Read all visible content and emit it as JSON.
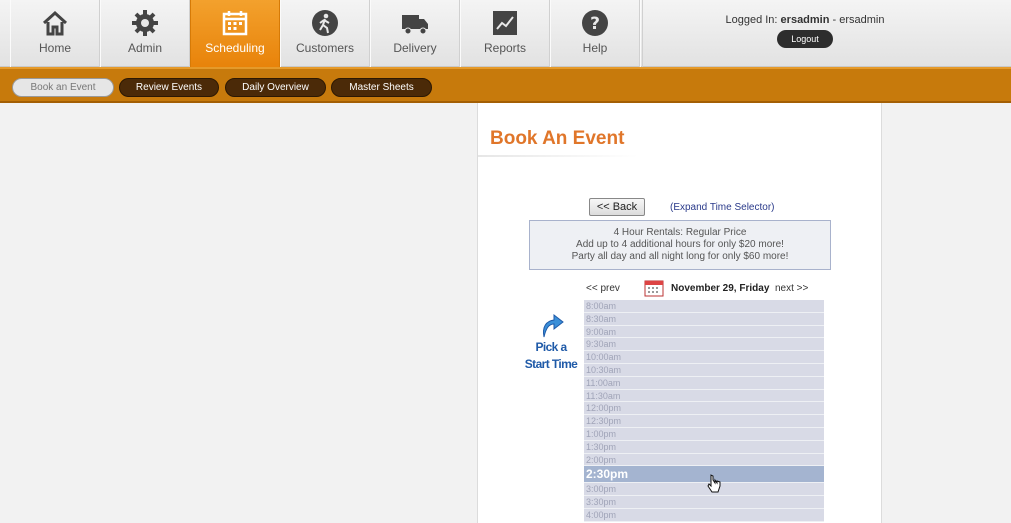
{
  "nav": {
    "items": [
      {
        "label": "Home",
        "icon": "home-icon"
      },
      {
        "label": "Admin",
        "icon": "gear-icon"
      },
      {
        "label": "Scheduling",
        "icon": "calendar-icon"
      },
      {
        "label": "Customers",
        "icon": "walking-person-icon"
      },
      {
        "label": "Delivery",
        "icon": "truck-icon"
      },
      {
        "label": "Reports",
        "icon": "chart-icon"
      },
      {
        "label": "Help",
        "icon": "question-icon"
      }
    ],
    "active": "Scheduling"
  },
  "login": {
    "prefix": "Logged In:",
    "username": "ersadmin",
    "suffix": " - ersadmin",
    "logout_label": "Logout"
  },
  "subnav": {
    "items": [
      "Book an Event",
      "Review Events",
      "Daily Overview",
      "Master Sheets"
    ],
    "active": "Book an Event"
  },
  "page": {
    "title": "Book An Event",
    "back_label": "<< Back",
    "expand_label": "(Expand Time Selector)",
    "promo": [
      "4 Hour Rentals: Regular Price",
      "Add up to 4 additional hours for only $20 more!",
      "Party all day and all night long for only $60 more!"
    ],
    "prev_label": "<< prev",
    "date_label": "November 29, Friday",
    "next_label": "next >>",
    "pick_line1": "Pick a",
    "pick_line2": "Start Time",
    "selected_slot": "2:30pm",
    "slots": [
      "8:00am",
      "8:30am",
      "9:00am",
      "9:30am",
      "10:00am",
      "10:30am",
      "11:00am",
      "11:30am",
      "12:00pm",
      "12:30pm",
      "1:00pm",
      "1:30pm",
      "2:00pm",
      "2:30pm",
      "3:00pm",
      "3:30pm",
      "4:00pm"
    ]
  },
  "colors": {
    "accent_orange": "#e8830a",
    "subnav_bar": "#c77a0c",
    "title_orange": "#e0762a",
    "link_blue": "#2a3a8a"
  }
}
